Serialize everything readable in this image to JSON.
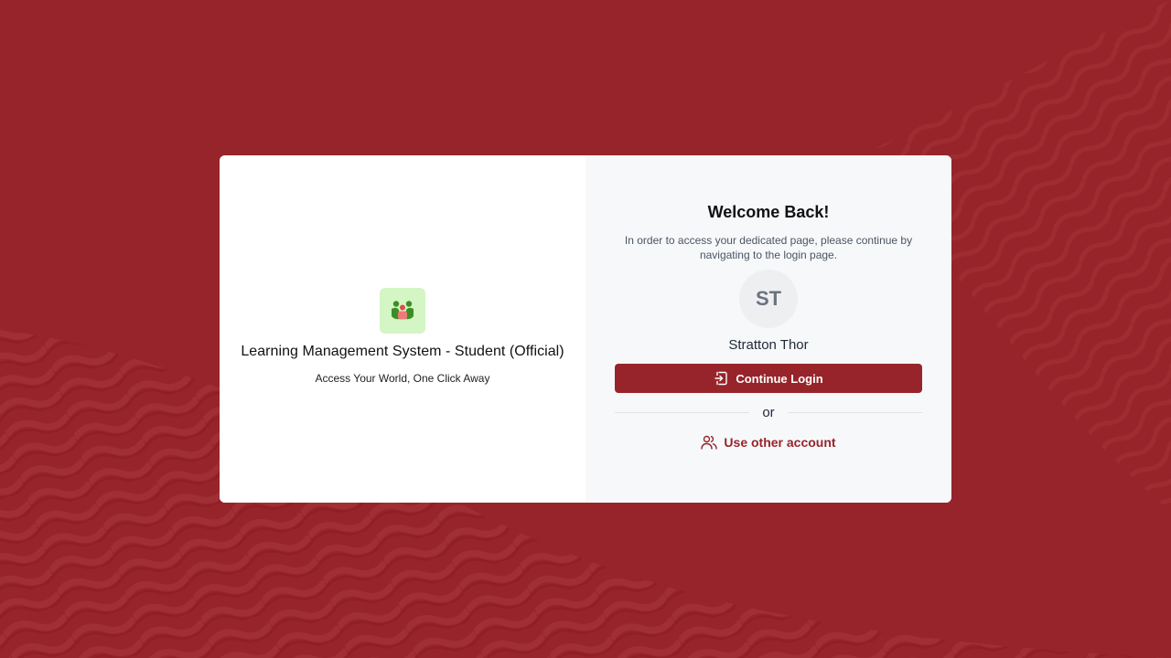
{
  "theme": {
    "background": "#97242a",
    "accent": "#97242a",
    "logo_background": "#d4f5c4"
  },
  "brand": {
    "logo_icon": "students-group-icon",
    "app_title": "Learning Management System - Student (Official)",
    "tagline": "Access Your World, One Click Away"
  },
  "login": {
    "heading": "Welcome Back!",
    "description": "In order to access your dedicated page, please continue by navigating to the login page.",
    "avatar_initials": "ST",
    "user_name": "Stratton Thor",
    "continue_label": "Continue Login",
    "continue_icon": "login-enter-icon",
    "divider_text": "or",
    "other_account_label": "Use other account",
    "other_account_icon": "users-icon"
  }
}
